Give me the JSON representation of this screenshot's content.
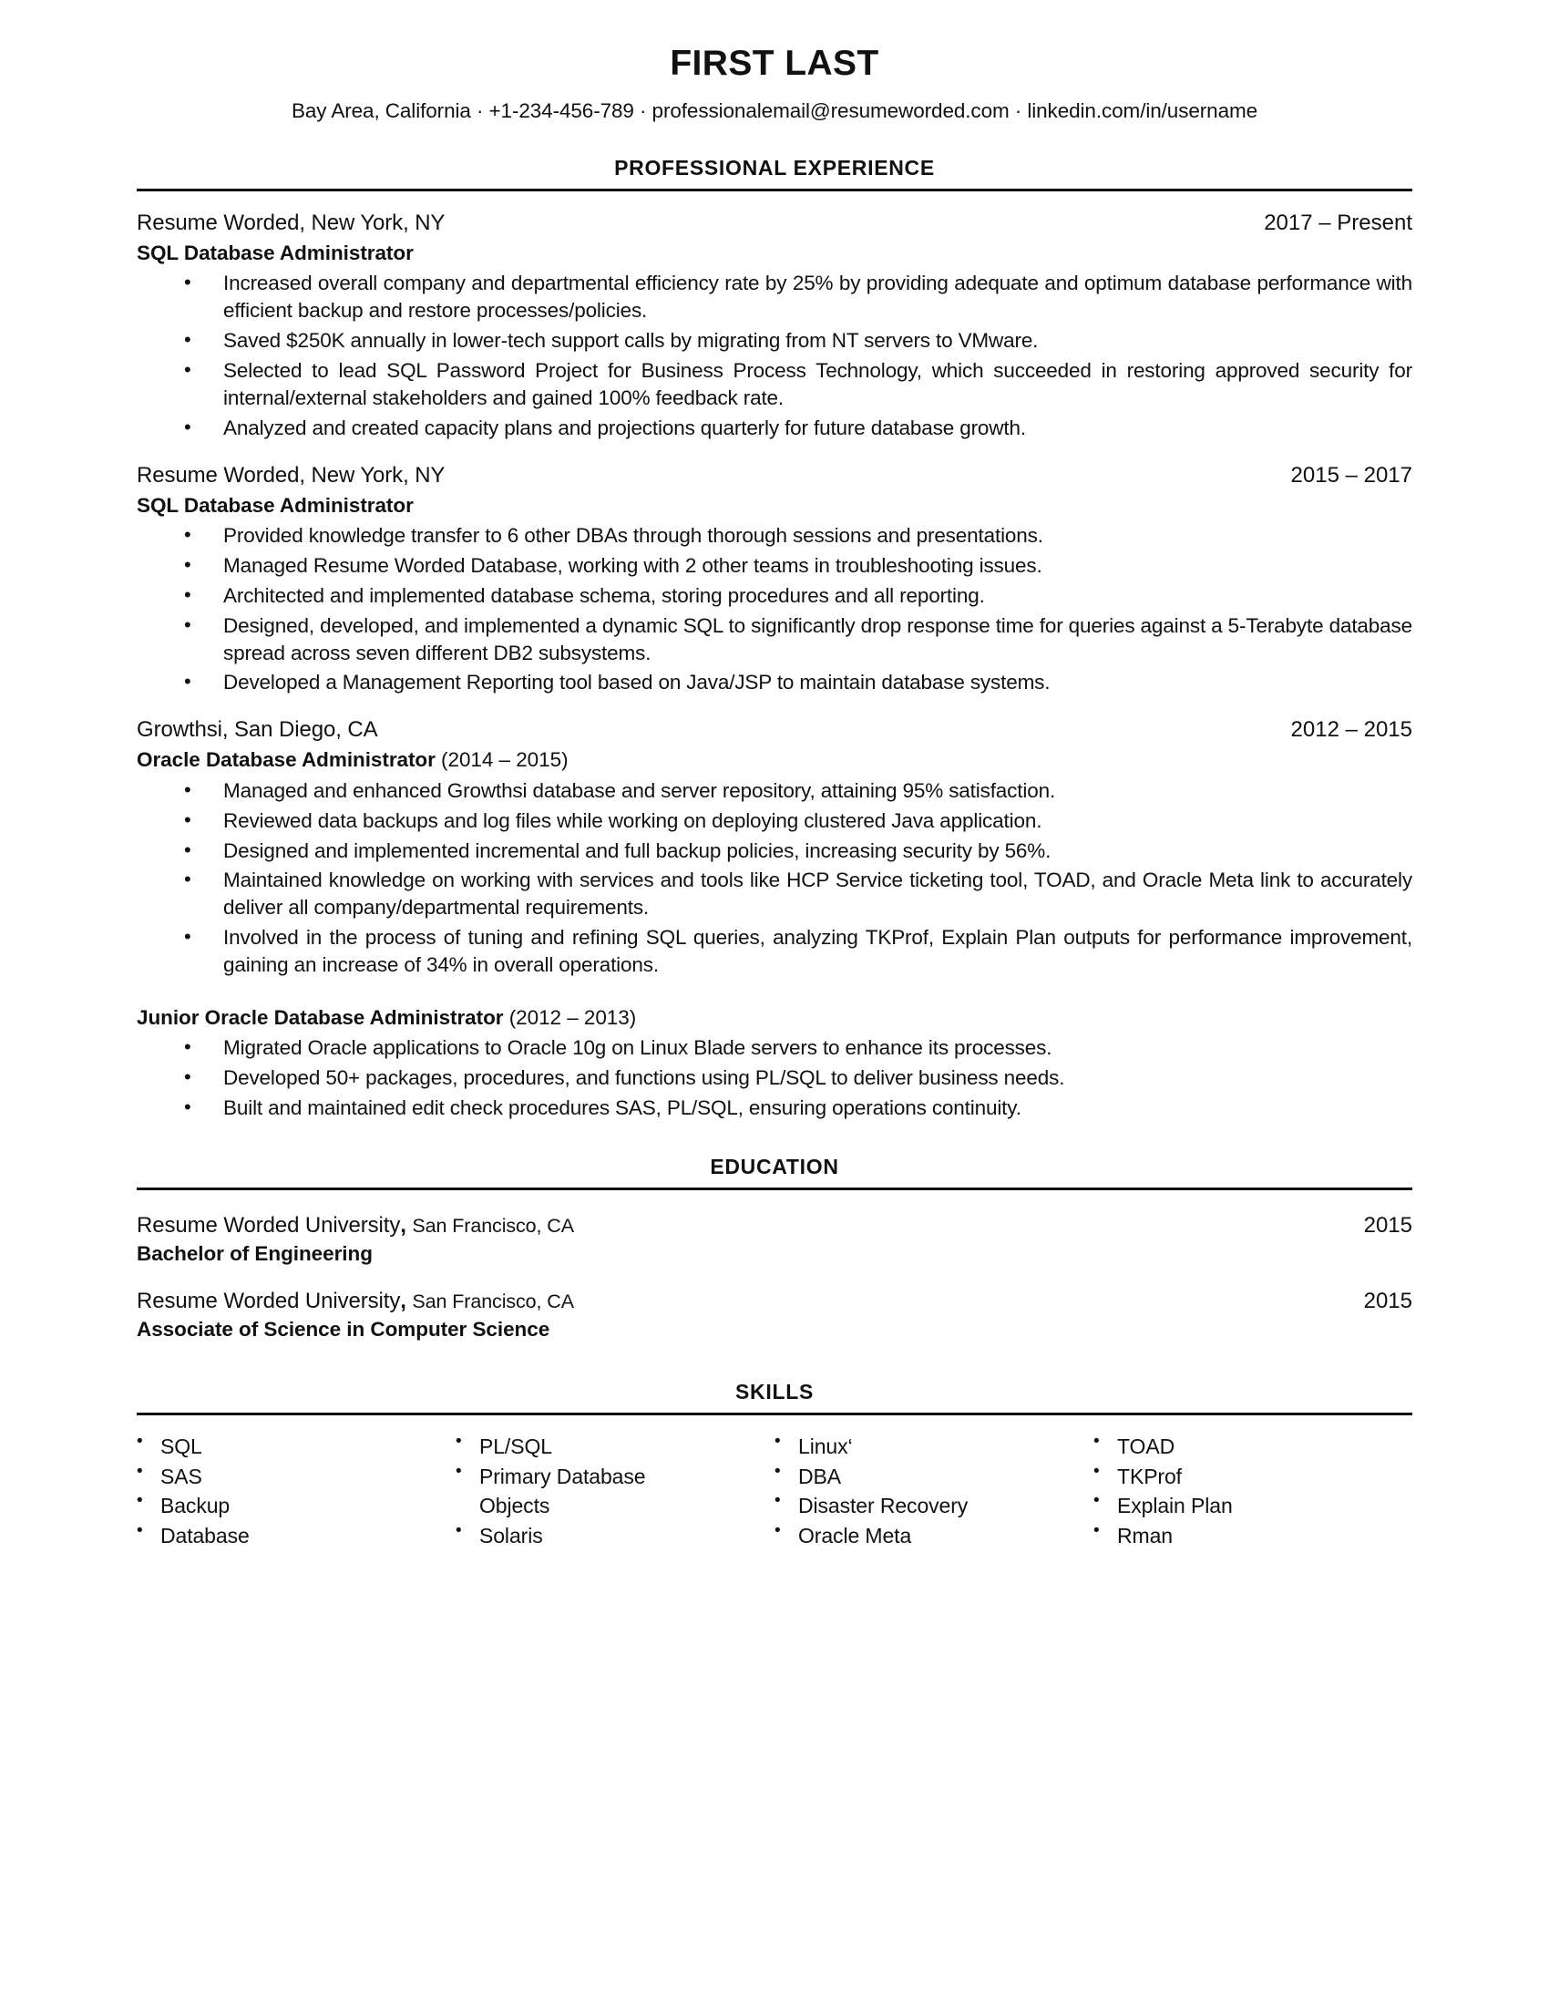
{
  "header": {
    "name": "FIRST LAST",
    "contact": "Bay Area, California · +1-234-456-789 · professionalemail@resumeworded.com · linkedin.com/in/username"
  },
  "sections": {
    "experience_title": "PROFESSIONAL EXPERIENCE",
    "education_title": "EDUCATION",
    "skills_title": "SKILLS"
  },
  "experience": [
    {
      "org": "Resume Worded, New York, NY",
      "dates": "2017 – Present",
      "role": "SQL Database Administrator",
      "bullets": [
        "Increased overall company and departmental efficiency rate by 25% by providing adequate and optimum database performance with efficient backup and restore processes/policies.",
        "Saved $250K annually in lower-tech support calls by migrating from NT servers to VMware.",
        "Selected to lead SQL Password Project for Business Process Technology, which succeeded in restoring approved security for internal/external stakeholders and gained 100% feedback rate.",
        "Analyzed and created capacity plans and projections quarterly for future database growth."
      ]
    },
    {
      "org": "Resume Worded, New York, NY",
      "dates": "2015 – 2017",
      "role": "SQL Database Administrator",
      "bullets": [
        "Provided knowledge transfer to 6 other DBAs through thorough sessions and presentations.",
        "Managed Resume Worded Database, working with 2 other teams in troubleshooting issues.",
        "Architected and implemented database schema, storing procedures and all reporting.",
        "Designed, developed, and implemented a dynamic SQL to significantly drop response time for queries against a 5-Terabyte database spread across seven different DB2 subsystems.",
        "Developed a Management Reporting tool based on Java/JSP to maintain database systems."
      ]
    },
    {
      "org": "Growthsi, San Diego, CA",
      "dates": "2012 – 2015",
      "role": "Oracle Database Administrator",
      "role_dates": "(2014 – 2015)",
      "bullets": [
        "Managed and enhanced Growthsi database and server repository, attaining 95% satisfaction.",
        "Reviewed data backups and log files while working on deploying clustered Java application.",
        "Designed and implemented incremental and full backup policies, increasing security by 56%.",
        "Maintained knowledge on working with services and tools like HCP Service ticketing tool, TOAD, and Oracle Meta link to accurately deliver all company/departmental requirements.",
        "Involved in the process of tuning and refining SQL queries, analyzing TKProf, Explain Plan outputs for performance improvement, gaining an increase of 34% in overall operations."
      ],
      "sub_role": "Junior Oracle Database Administrator",
      "sub_role_dates": "(2012 – 2013)",
      "sub_bullets": [
        "Migrated Oracle applications to Oracle 10g on Linux Blade servers to enhance its processes.",
        "Developed 50+ packages, procedures, and functions using PL/SQL to deliver business needs.",
        "Built and maintained edit check procedures SAS, PL/SQL, ensuring operations continuity."
      ]
    }
  ],
  "education": [
    {
      "school": "Resume Worded University",
      "location": "San Francisco, CA",
      "year": "2015",
      "degree": "Bachelor of Engineering"
    },
    {
      "school": "Resume Worded University",
      "location": "San Francisco, CA",
      "year": "2015",
      "degree": "Associate of Science in Computer Science"
    }
  ],
  "skills": {
    "columns": [
      [
        "SQL",
        "SAS",
        "Backup",
        "Database"
      ],
      [
        "PL/SQL",
        "Primary Database",
        "Objects",
        "Solaris"
      ],
      [
        "Linux‘",
        "DBA",
        "Disaster Recovery",
        "Oracle Meta"
      ],
      [
        "TOAD",
        "TKProf",
        "Explain Plan",
        "Rman"
      ]
    ],
    "wrapped_continuation": {
      "column": 1,
      "index": 2
    }
  }
}
